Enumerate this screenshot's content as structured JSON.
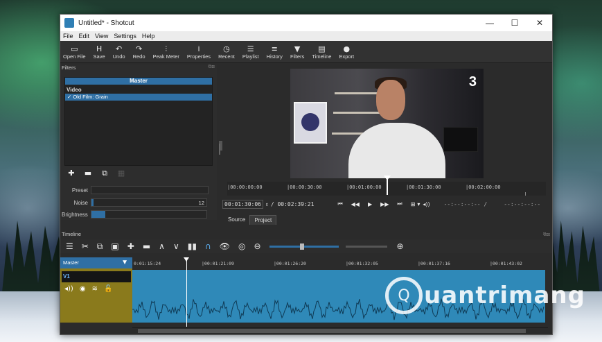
{
  "window": {
    "title": "Untitled* - Shotcut",
    "controls": {
      "minimize": "—",
      "maximize": "☐",
      "close": "✕"
    }
  },
  "menu": [
    "File",
    "Edit",
    "View",
    "Settings",
    "Help"
  ],
  "toolbar": [
    {
      "label": "Open File",
      "icon": "folder-icon",
      "glyph": "▭"
    },
    {
      "label": "Save",
      "icon": "save-icon",
      "glyph": "H"
    },
    {
      "label": "Undo",
      "icon": "undo-icon",
      "glyph": "↶"
    },
    {
      "label": "Redo",
      "icon": "redo-icon",
      "glyph": "↷"
    },
    {
      "label": "Peak Meter",
      "icon": "peak-meter-icon",
      "glyph": "⫶"
    },
    {
      "label": "Properties",
      "icon": "info-icon",
      "glyph": "i"
    },
    {
      "label": "Recent",
      "icon": "clock-icon",
      "glyph": "◷"
    },
    {
      "label": "Playlist",
      "icon": "playlist-icon",
      "glyph": "☰"
    },
    {
      "label": "History",
      "icon": "history-icon",
      "glyph": "≡"
    },
    {
      "label": "Filters",
      "icon": "filter-icon",
      "glyph": "▼"
    },
    {
      "label": "Timeline",
      "icon": "timeline-icon",
      "glyph": "▤"
    },
    {
      "label": "Export",
      "icon": "export-icon",
      "glyph": "●"
    }
  ],
  "filters_panel": {
    "title": "Filters",
    "master_label": "Master",
    "video_section": "Video",
    "items": [
      "✓ Old Film: Grain"
    ],
    "buttons": [
      {
        "name": "add-filter-button",
        "glyph": "✚"
      },
      {
        "name": "remove-filter-button",
        "glyph": "▬"
      },
      {
        "name": "copy-filter-button",
        "glyph": "⧉"
      },
      {
        "name": "deselect-filter-button",
        "glyph": "▦"
      }
    ],
    "preset_label": "Preset",
    "noise_label": "Noise",
    "noise_value": "12",
    "brightness_label": "Brightness"
  },
  "player": {
    "ruler_ticks": [
      "|00:00:00:00",
      "|00:00:30:00",
      "|00:01:00:00",
      "|00:01:30:00",
      "|00:02:00:00"
    ],
    "current_time": "00:01:30:06",
    "total_time": "/ 00:02:39:21",
    "in_point": "--:--:--:-- /",
    "out_point": "--:--:--:--",
    "tabs": [
      "Source",
      "Project"
    ],
    "active_tab": "Project",
    "controls": [
      "⏮",
      "◀◀",
      "▶",
      "▶▶",
      "⏭",
      "⊞",
      "▾",
      "◂))"
    ],
    "overlay_logo": "3"
  },
  "timeline": {
    "title": "Timeline",
    "tools": [
      {
        "name": "menu-icon",
        "glyph": "☰"
      },
      {
        "name": "cut-icon",
        "glyph": "✂"
      },
      {
        "name": "copy-icon",
        "glyph": "⧉"
      },
      {
        "name": "paste-icon",
        "glyph": "▣"
      },
      {
        "name": "append-icon",
        "glyph": "✚"
      },
      {
        "name": "remove-icon",
        "glyph": "▬"
      },
      {
        "name": "lift-icon",
        "glyph": "∧"
      },
      {
        "name": "overwrite-icon",
        "glyph": "∨"
      },
      {
        "name": "split-icon",
        "glyph": "▮▮"
      },
      {
        "name": "snap-icon",
        "glyph": "∩"
      },
      {
        "name": "scrub-icon",
        "glyph": "👁"
      },
      {
        "name": "ripple-icon",
        "glyph": "◎"
      },
      {
        "name": "zoom-out-icon",
        "glyph": "⊖"
      },
      {
        "name": "zoom-in-icon",
        "glyph": "⊕"
      }
    ],
    "zoom_level": 0.45,
    "master_label": "Master",
    "track_label": "V1",
    "track_controls": [
      "◂))",
      "◉",
      "≋",
      "🔓"
    ],
    "ruler": [
      "0:01:15:24",
      "|00:01:21:09",
      "|00:01:26:20",
      "|00:01:32:05",
      "|00:01:37:16",
      "|00:01:43:02"
    ]
  },
  "watermark": {
    "text": "uantrimang",
    "logo_glyph": "Q"
  }
}
